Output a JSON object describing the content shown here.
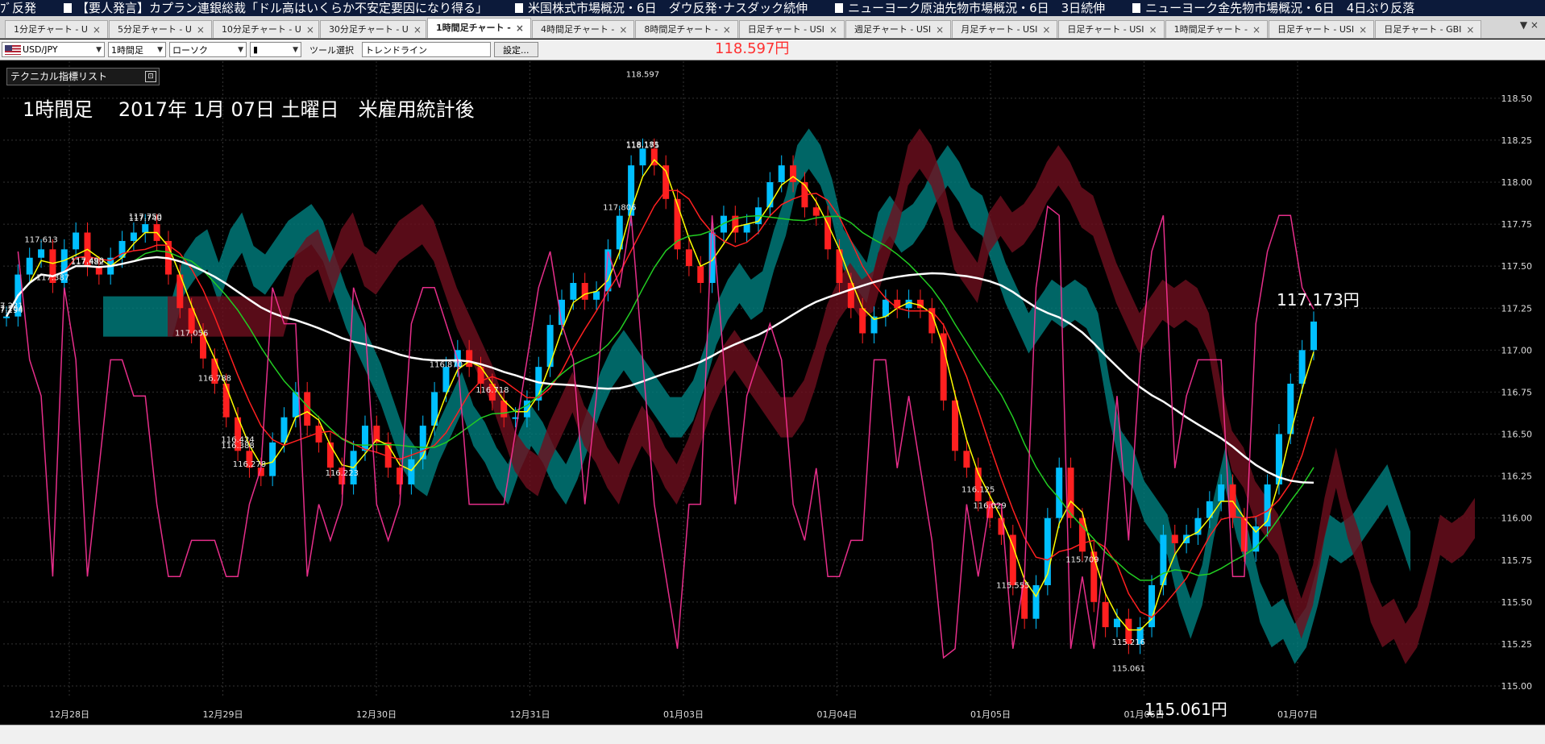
{
  "ticker": [
    "ﾌﾞ反発",
    "【要人発言】カプラン連銀総裁「ドル高はいくらか不安定要因になり得る」",
    "米国株式市場概況・6日　ダウ反発･ナスダック続伸",
    "ニューヨーク原油先物市場概況・6日　3日続伸",
    "ニューヨーク金先物市場概況・6日　4日ぶり反落"
  ],
  "tabs": [
    {
      "label": "1分足チャート - U",
      "active": false
    },
    {
      "label": "5分足チャート - U",
      "active": false
    },
    {
      "label": "10分足チャート - U",
      "active": false
    },
    {
      "label": "30分足チャート - U",
      "active": false
    },
    {
      "label": "1時間足チャート -",
      "active": true
    },
    {
      "label": "4時間足チャート -",
      "active": false
    },
    {
      "label": "8時間足チャート -",
      "active": false
    },
    {
      "label": "日足チャート - USI",
      "active": false
    },
    {
      "label": "週足チャート - USI",
      "active": false
    },
    {
      "label": "月足チャート - USI",
      "active": false
    },
    {
      "label": "日足チャート - USI",
      "active": false
    },
    {
      "label": "1時間足チャート -",
      "active": false
    },
    {
      "label": "日足チャート - USI",
      "active": false
    },
    {
      "label": "日足チャート - GBI",
      "active": false
    }
  ],
  "tab_menu": "▼ ×",
  "toolbar": {
    "symbol": "USD/JPY",
    "timeframe": "1時間足",
    "chart_type": "ローソク",
    "candle_glyph": "▮",
    "tool_label": "ツール選択",
    "tool_value": "トレンドライン",
    "settings_button": "設定..."
  },
  "price_top": "118.597円",
  "indicator_panel": "テクニカル指標リスト",
  "indicator_panel_button": "⊡",
  "caption": "1時間足　 2017年 1月 07日 土曜日　米雇用統計後",
  "labels": {
    "high": "117.173円",
    "low": "115.061円"
  },
  "colors": {
    "bg": "#000000",
    "up": "#00bfff",
    "down": "#ff2020",
    "cloud_bull": "#008080",
    "cloud_bull2": "#009000",
    "cloud_bear": "#6e0f1e",
    "cloud_bear2": "#253a78",
    "rsi": "#ff3399",
    "ma_fast": "#ffff00",
    "ma_mid": "#ff2020",
    "ma_slow": "#22cc22",
    "ma_long": "#ffffff",
    "tenkan": "#3399ff"
  },
  "chart_data": {
    "type": "candlestick",
    "title": "1時間足　 2017年 1月 07日 土曜日　米雇用統計後",
    "symbol": "USD/JPY",
    "ylim": [
      115.0,
      118.6
    ],
    "yticks": [
      "118.50",
      "118.25",
      "118.00",
      "117.75",
      "117.50",
      "117.25",
      "117.00",
      "116.75",
      "116.50",
      "116.25",
      "116.00",
      "115.75",
      "115.50",
      "115.25",
      "115.00"
    ],
    "xticks": [
      "12月28日",
      "12月29日",
      "12月30日",
      "12月31日",
      "01月03日",
      "01月04日",
      "01月05日",
      "01月06日",
      "01月07日"
    ],
    "annotations": [
      "118.597",
      "118.181",
      "118.175",
      "117.806",
      "117.750",
      "117.740",
      "117.613",
      "117.490",
      "117.482",
      "117.387",
      "117.221",
      "117.204",
      "117.194",
      "117.056",
      "116.870",
      "116.788",
      "116.718",
      "116.424",
      "116.388",
      "116.278",
      "116.223",
      "116.125",
      "116.029",
      "115.709",
      "115.555",
      "115.216",
      "115.061"
    ],
    "key_prices": {
      "high": 118.597,
      "low": 115.061,
      "last": 117.173
    },
    "close_path": [
      117.2,
      117.45,
      117.55,
      117.6,
      117.4,
      117.6,
      117.7,
      117.5,
      117.45,
      117.55,
      117.65,
      117.7,
      117.75,
      117.65,
      117.45,
      117.25,
      117.1,
      116.95,
      116.8,
      116.6,
      116.4,
      116.3,
      116.25,
      116.45,
      116.6,
      116.75,
      116.55,
      116.45,
      116.3,
      116.2,
      116.4,
      116.55,
      116.45,
      116.3,
      116.2,
      116.35,
      116.55,
      116.75,
      116.9,
      117.0,
      116.9,
      116.8,
      116.7,
      116.6,
      116.6,
      116.7,
      116.9,
      117.15,
      117.3,
      117.4,
      117.3,
      117.35,
      117.6,
      117.8,
      118.1,
      118.2,
      118.1,
      117.9,
      117.6,
      117.5,
      117.4,
      117.7,
      117.8,
      117.7,
      117.75,
      117.85,
      118.0,
      118.1,
      118.0,
      117.85,
      117.8,
      117.6,
      117.4,
      117.25,
      117.1,
      117.2,
      117.3,
      117.25,
      117.3,
      117.25,
      117.1,
      116.7,
      116.4,
      116.3,
      116.1,
      116.0,
      115.9,
      115.6,
      115.4,
      115.6,
      116.0,
      116.3,
      116.0,
      115.8,
      115.5,
      115.35,
      115.4,
      115.25,
      115.35,
      115.6,
      115.9,
      115.85,
      115.9,
      116.0,
      116.1,
      116.2,
      116.0,
      115.8,
      115.95,
      116.2,
      116.5,
      116.8,
      117.0,
      117.17
    ]
  }
}
